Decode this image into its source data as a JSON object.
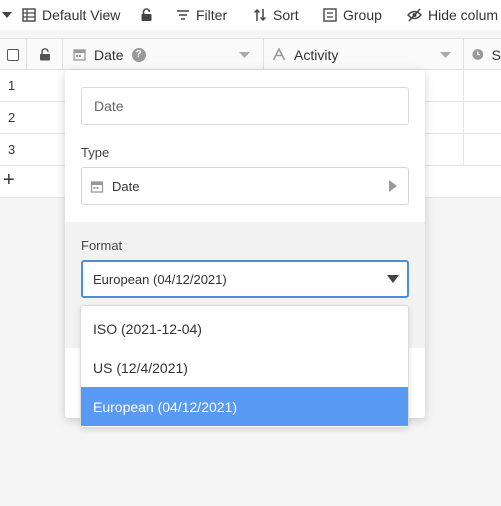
{
  "toolbar": {
    "view_label": "Default View",
    "filter_label": "Filter",
    "sort_label": "Sort",
    "group_label": "Group",
    "hide_label": "Hide colum"
  },
  "grid": {
    "columns": [
      {
        "label": "Date",
        "icon": "calendar-icon"
      },
      {
        "label": "Activity",
        "icon": "text-type-icon"
      },
      {
        "label": "S",
        "icon": "clock-icon"
      }
    ],
    "rows": [
      "1",
      "2",
      "3"
    ],
    "add_row": "+"
  },
  "popover": {
    "name_value": "Date",
    "type_label": "Type",
    "type_value": "Date",
    "format_label": "Format",
    "format_value": "European (04/12/2021)"
  },
  "format_options": [
    {
      "label": "ISO (2021-12-04)",
      "selected": false
    },
    {
      "label": "US (12/4/2021)",
      "selected": false
    },
    {
      "label": "European (04/12/2021)",
      "selected": true
    }
  ],
  "colors": {
    "accent": "#599af4",
    "focus_border": "#4a8fd8"
  }
}
